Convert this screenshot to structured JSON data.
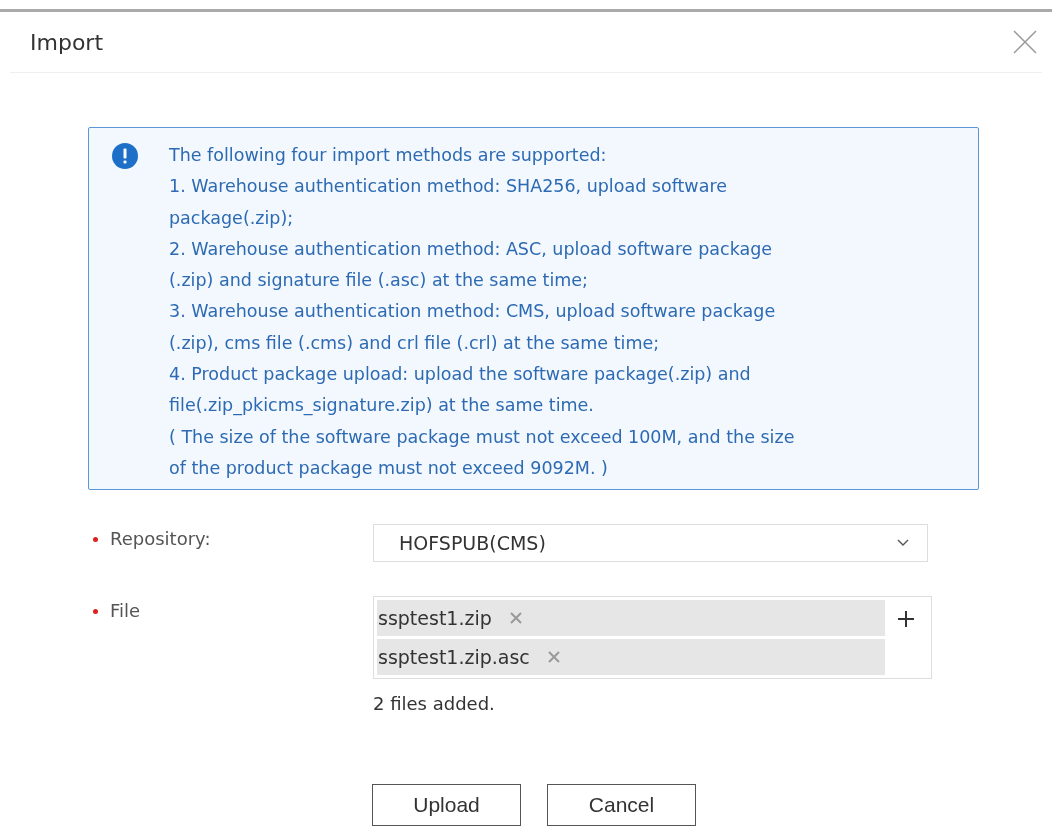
{
  "dialog": {
    "title": "Import"
  },
  "notice": {
    "lines": [
      "The following four import methods are supported:",
      "1. Warehouse authentication method: SHA256, upload software",
      "package(.zip);",
      "2. Warehouse authentication method: ASC, upload software package",
      "(.zip) and signature file (.asc) at the same time;",
      "3. Warehouse authentication method: CMS, upload software package",
      "(.zip), cms file (.cms) and crl file (.crl) at the same time;",
      "4. Product package upload: upload the software package(.zip) and",
      "file(.zip_pkicms_signature.zip) at the same time.",
      "( The size of the software package must not exceed 100M, and the size",
      "of the product package must not exceed 9092M. )"
    ]
  },
  "form": {
    "repository": {
      "label": "Repository:",
      "required": true,
      "value": "HOFSPUB(CMS)"
    },
    "file": {
      "label": "File",
      "required": true,
      "files": [
        "ssptest1.zip",
        "ssptest1.zip.asc"
      ],
      "status": "2 files added."
    }
  },
  "buttons": [
    "Upload",
    "Cancel"
  ]
}
